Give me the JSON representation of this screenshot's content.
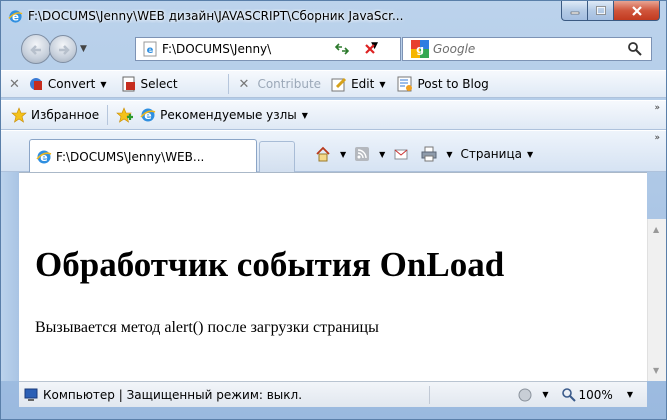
{
  "window": {
    "title": "F:\\DOCUMS\\Jenny\\WEB дизайн\\JAVASCRIPT\\Сборник JavaScr..."
  },
  "nav": {
    "address": "F:\\DOCUMS\\Jenny\\",
    "search_placeholder": "Google"
  },
  "toolbar1": {
    "convert": "Convert",
    "select": "Select",
    "contribute": "Contribute",
    "edit": "Edit",
    "post_to_blog": "Post to Blog"
  },
  "toolbar2": {
    "favorites": "Избранное",
    "suggested_sites": "Рекомендуемые узлы"
  },
  "tab": {
    "label": "F:\\DOCUMS\\Jenny\\WEB..."
  },
  "command_bar": {
    "page": "Страница"
  },
  "content": {
    "heading": "Обработчик события OnLoad",
    "text": "Вызывается метод alert() после загрузки страницы"
  },
  "status": {
    "zone": "Компьютер | Защищенный режим: выкл.",
    "zoom": "100%"
  },
  "colors": {
    "frame": "#a9c4e4",
    "close_button": "#c23a1f"
  }
}
